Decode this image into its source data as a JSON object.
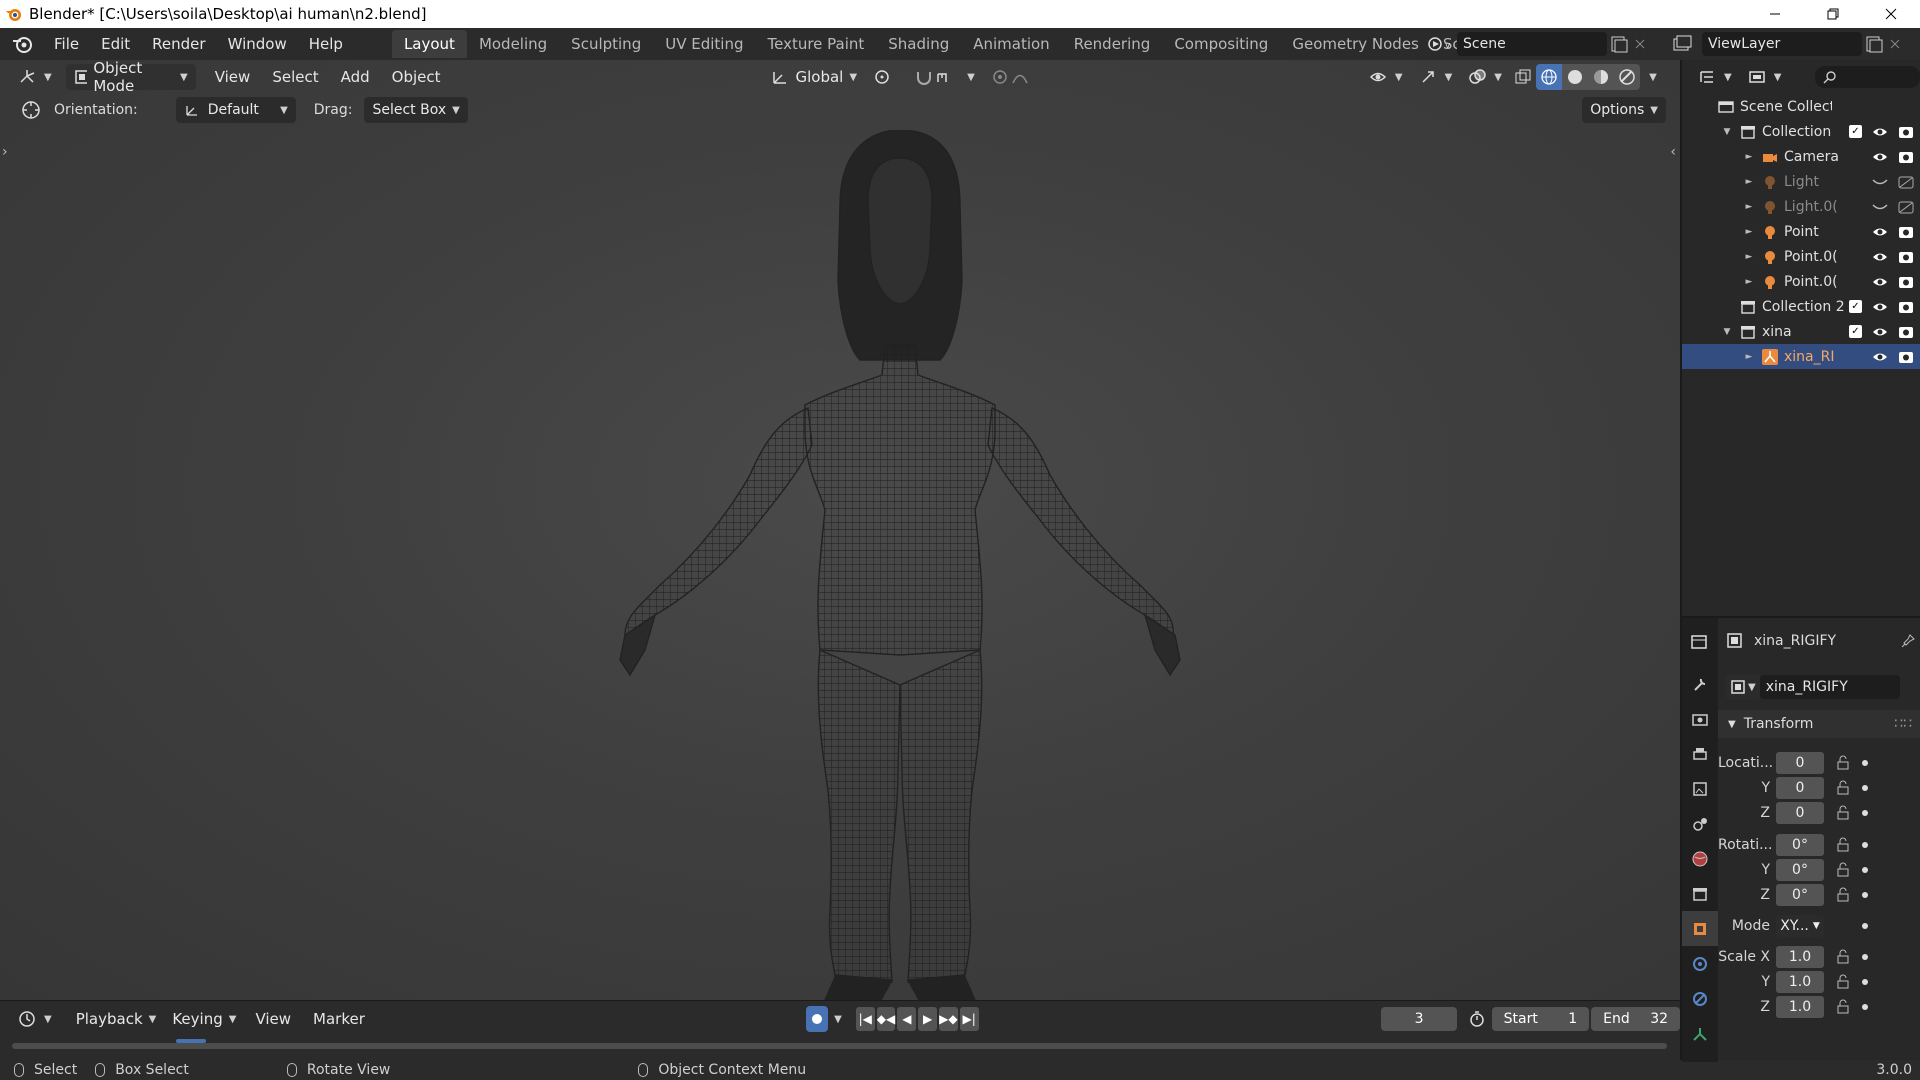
{
  "window": {
    "title": "Blender* [C:\\Users\\soila\\Desktop\\ai human\\n2.blend]"
  },
  "menu": [
    "File",
    "Edit",
    "Render",
    "Window",
    "Help"
  ],
  "workspaces": [
    {
      "label": "Layout",
      "active": true
    },
    {
      "label": "Modeling"
    },
    {
      "label": "Sculpting"
    },
    {
      "label": "UV Editing"
    },
    {
      "label": "Texture Paint"
    },
    {
      "label": "Shading"
    },
    {
      "label": "Animation"
    },
    {
      "label": "Rendering"
    },
    {
      "label": "Compositing"
    },
    {
      "label": "Geometry Nodes"
    },
    {
      "label": "Scripting"
    }
  ],
  "workspace_add": "+",
  "scene": {
    "name": "Scene"
  },
  "view_layer": {
    "name": "ViewLayer"
  },
  "viewport": {
    "mode": "Object Mode",
    "menus": [
      "View",
      "Select",
      "Add",
      "Object"
    ],
    "transform_orientation": "Global",
    "orientation_label": "Orientation:",
    "orientation_value": "Default",
    "drag_label": "Drag:",
    "drag_value": "Select Box",
    "options_label": "Options"
  },
  "timeline": {
    "menus": [
      "Playback",
      "Keying",
      "View",
      "Marker"
    ],
    "current_frame": "3",
    "start_label": "Start",
    "start_value": "1",
    "end_label": "End",
    "end_value": "32"
  },
  "statusbar": {
    "select": "Select",
    "box_select": "Box Select",
    "rotate_view": "Rotate View",
    "context_menu": "Object Context Menu",
    "version": "3.0.0"
  },
  "outliner": {
    "rows": [
      {
        "label": "Scene Collectio",
        "indent": 0,
        "type": "scene"
      },
      {
        "label": "Collection",
        "indent": 1,
        "type": "collection",
        "expanded": true,
        "checkbox": true
      },
      {
        "label": "Camera",
        "indent": 2,
        "type": "camera"
      },
      {
        "label": "Light",
        "indent": 2,
        "type": "light",
        "dim": true
      },
      {
        "label": "Light.0(",
        "indent": 2,
        "type": "light",
        "dim": true
      },
      {
        "label": "Point",
        "indent": 2,
        "type": "light"
      },
      {
        "label": "Point.0(",
        "indent": 2,
        "type": "light"
      },
      {
        "label": "Point.0(",
        "indent": 2,
        "type": "light"
      },
      {
        "label": "Collection 2",
        "indent": 1,
        "type": "collection",
        "checkbox": true
      },
      {
        "label": "xina",
        "indent": 1,
        "type": "collection",
        "expanded": true,
        "checkbox": true
      },
      {
        "label": "xina_RI",
        "indent": 2,
        "type": "armature",
        "selected": true
      }
    ]
  },
  "properties": {
    "object_name": "xina_RIGIFY",
    "object_data_name": "xina_RIGIFY",
    "panel_title": "Transform",
    "location_label": "Locati...",
    "location": [
      "0",
      "0",
      "0"
    ],
    "rotation_label": "Rotati...",
    "rotation": [
      "0°",
      "0°",
      "0°"
    ],
    "mode_label": "Mode",
    "mode_value": "XY...",
    "scale_label": "Scale X",
    "scale": [
      "1.0",
      "1.0",
      "1.0"
    ],
    "axis_y": "Y",
    "axis_z": "Z"
  },
  "colors": {
    "accent": "#4772b3",
    "selection": "#334d80",
    "object_orange": "#e98a3c",
    "background": "#3f3f3f"
  }
}
